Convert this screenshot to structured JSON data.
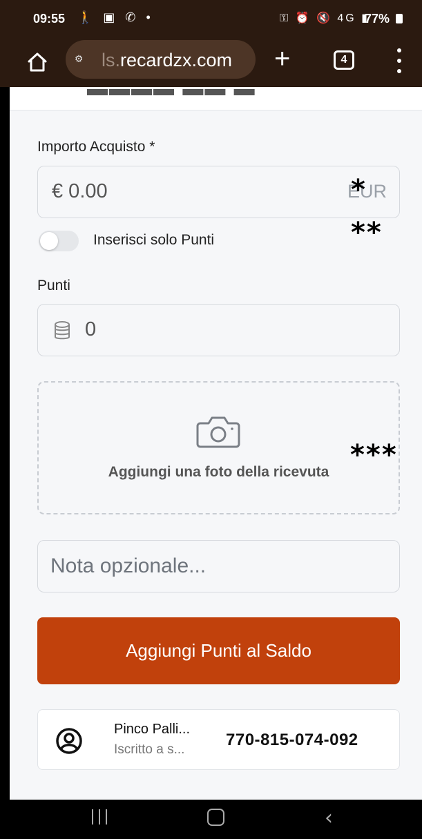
{
  "status_bar": {
    "time": "09:55",
    "left_icons": "🚶 ▣ ✆ •",
    "right_icons": "⚿ ⏰ 🔇 4G ▮",
    "battery": "77%"
  },
  "browser": {
    "url_prefix": "ls.",
    "url_domain": "recardzx.com",
    "tab_count": "4",
    "icons": [
      "home-icon",
      "site-settings-icon",
      "plus-icon",
      "tabs-icon",
      "menu-icon"
    ]
  },
  "form": {
    "amount_label": "Importo Acquisto *",
    "amount_value": "€  0.00",
    "amount_currency": "EUR",
    "toggle_label": "Inserisci solo Punti",
    "toggle_on": false,
    "points_label": "Punti",
    "points_value": "0",
    "upload_text": "Aggiungi una foto della ricevuta",
    "note_placeholder": "Nota opzionale...",
    "submit_label": "Aggiungi Punti al Saldo"
  },
  "customer": {
    "name": "Pinco Palli...",
    "subtitle": "Iscritto a s...",
    "code": "770-815-074-092"
  },
  "annotations": {
    "mark1": "*",
    "mark2": "**",
    "mark3": "***"
  },
  "colors": {
    "accent": "#c1410c",
    "browser_bar": "#2b1a10"
  }
}
